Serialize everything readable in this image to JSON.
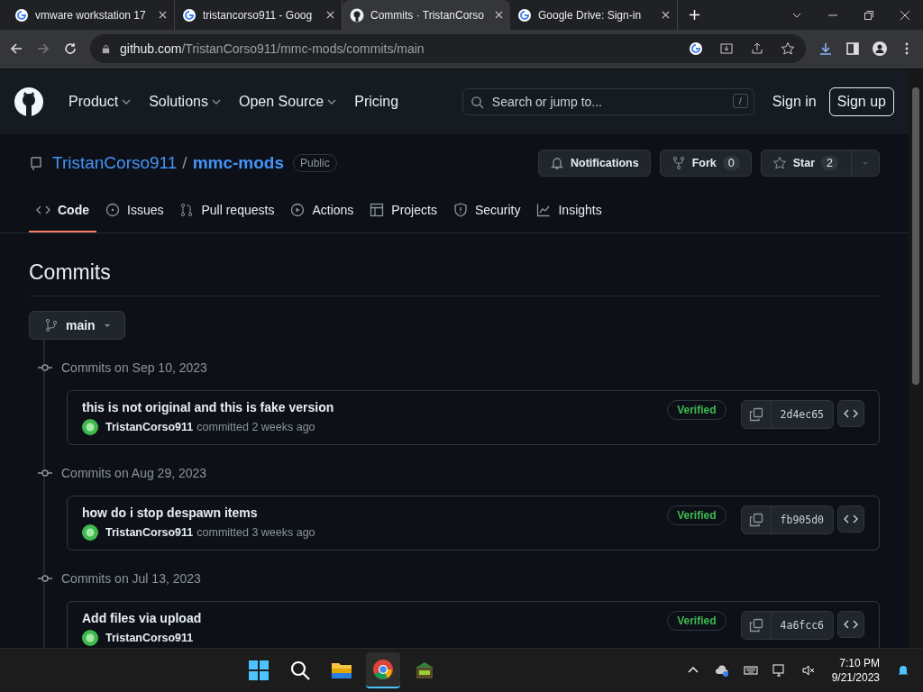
{
  "browser": {
    "tabs": [
      {
        "title": "vmware workstation 17",
        "selected": false
      },
      {
        "title": "tristancorso911 - Goog",
        "selected": false
      },
      {
        "title": "Commits · TristanCorso",
        "selected": true
      },
      {
        "title": "Google Drive: Sign-in",
        "selected": false
      }
    ],
    "address": {
      "host": "github.com",
      "path": "/TristanCorso911/mmc-mods/commits/main"
    }
  },
  "header": {
    "nav": [
      {
        "label": "Product",
        "dropdown": true
      },
      {
        "label": "Solutions",
        "dropdown": true
      },
      {
        "label": "Open Source",
        "dropdown": true
      },
      {
        "label": "Pricing",
        "dropdown": false
      }
    ],
    "search": {
      "placeholder": "Search or jump to...",
      "shortcut": "/"
    },
    "sign_in": "Sign in",
    "sign_up": "Sign up"
  },
  "repo": {
    "owner": "TristanCorso911",
    "separator": "/",
    "name": "mmc-mods",
    "visibility": "Public",
    "notifications": "Notifications",
    "fork": {
      "label": "Fork",
      "count": "0"
    },
    "star": {
      "label": "Star",
      "count": "2"
    },
    "tabs": [
      {
        "label": "Code",
        "selected": true
      },
      {
        "label": "Issues",
        "selected": false
      },
      {
        "label": "Pull requests",
        "selected": false
      },
      {
        "label": "Actions",
        "selected": false
      },
      {
        "label": "Projects",
        "selected": false
      },
      {
        "label": "Security",
        "selected": false
      },
      {
        "label": "Insights",
        "selected": false
      }
    ]
  },
  "page_title": "Commits",
  "branch": "main",
  "groups": [
    {
      "date": "Commits on Sep 10, 2023",
      "commits": [
        {
          "message": "this is not original and this is fake version",
          "author": "TristanCorso911",
          "when": "committed 2 weeks ago",
          "badge": "Verified",
          "sha": "2d4ec65"
        }
      ]
    },
    {
      "date": "Commits on Aug 29, 2023",
      "commits": [
        {
          "message": "how do i stop despawn items",
          "author": "TristanCorso911",
          "when": "committed 3 weeks ago",
          "badge": "Verified",
          "sha": "fb905d0"
        }
      ]
    },
    {
      "date": "Commits on Jul 13, 2023",
      "commits": [
        {
          "message": "Add files via upload",
          "author": "TristanCorso911",
          "badge": "Verified",
          "sha": "4a6fcc6"
        }
      ]
    }
  ],
  "taskbar": {
    "time": "7:10 PM",
    "date": "9/21/2023"
  }
}
